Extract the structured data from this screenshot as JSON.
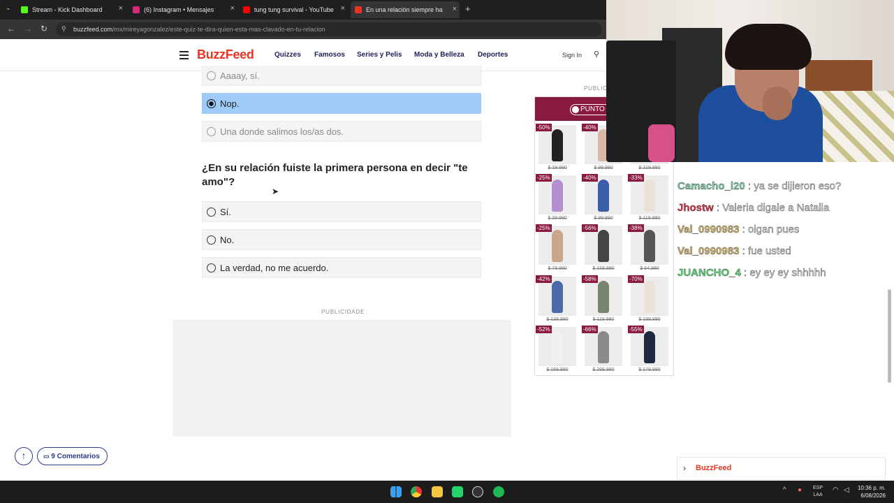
{
  "browser": {
    "tabs": [
      {
        "title": "Stream - Kick Dashboard",
        "icon": "kick-icon",
        "color": "#53fc18"
      },
      {
        "title": "(6) Instagram • Mensajes",
        "icon": "instagram-icon",
        "color": "#d62976"
      },
      {
        "title": "tung tung survival - YouTube",
        "icon": "youtube-icon",
        "color": "#ff0000"
      },
      {
        "title": "En una relación siempre hay un",
        "icon": "buzzfeed-icon",
        "color": "#e32"
      }
    ],
    "new_tab": "+",
    "url_domain": "buzzfeed.com",
    "url_path": "/mx/mireyagonzalez/este-quiz-te-dira-quien-esta-mas-clavado-en-tu-relacion"
  },
  "site": {
    "logo": "BuzzFeed",
    "nav": [
      "Quizzes",
      "Famosos",
      "Series y Pelis",
      "Moda y Belleza",
      "Deportes"
    ],
    "signin": "Sign In"
  },
  "quiz": {
    "previous_options": [
      {
        "label": "Aaaay, sí.",
        "state": "faded"
      },
      {
        "label": "Nop.",
        "state": "selected"
      },
      {
        "label": "Una donde salimos los/as dos.",
        "state": "faded"
      }
    ],
    "question": "¿En su relación fuiste la primera persona en decir \"te amo\"?",
    "options": [
      "Sí.",
      "No.",
      "La verdad, no me acuerdo."
    ]
  },
  "ads": {
    "publicidade": "PUBLICIDADE",
    "side_label": "PUBLICI",
    "brand": "PUNTO",
    "brand_color": "#8a1a3d",
    "products": [
      {
        "discount": "-50%",
        "price": "$ 19.990",
        "color": "#222"
      },
      {
        "discount": "-40%",
        "price": "$ 99.990",
        "color": "#d9b8a8"
      },
      {
        "discount": "",
        "price": "$ 219.990",
        "color": "#ececec"
      },
      {
        "discount": "-25%",
        "price": "$ 39.990",
        "color": "#b48fcf"
      },
      {
        "discount": "-40%",
        "price": "$ 99.990",
        "color": "#3b5ea8"
      },
      {
        "discount": "-33%",
        "price": "$ 119.990",
        "color": "#e9e3d7"
      },
      {
        "discount": "-25%",
        "price": "$ 79.990",
        "color": "#c9a58c"
      },
      {
        "discount": "-56%",
        "price": "$ 159.990",
        "color": "#444"
      },
      {
        "discount": "-38%",
        "price": "$ 64.990",
        "color": "#555"
      },
      {
        "discount": "-42%",
        "price": "$ 139.990",
        "color": "#4a6aa8"
      },
      {
        "discount": "-58%",
        "price": "$ 119.990",
        "color": "#7a8270"
      },
      {
        "discount": "-70%",
        "price": "$ 199.990",
        "color": "#e9e2d6"
      },
      {
        "discount": "-52%",
        "price": "$ 169.990",
        "color": "#f0f0f0"
      },
      {
        "discount": "-66%",
        "price": "$ 289.990",
        "color": "#8a8a8a"
      },
      {
        "discount": "-55%",
        "price": "$ 179.990",
        "color": "#1e2a40"
      }
    ]
  },
  "chat": {
    "messages": [
      {
        "user": "Camacho_l20",
        "text": ": ya se dijieron eso?",
        "color": "#7fd4a8"
      },
      {
        "user": "Jhostw",
        "text": ": Valeria digale a Natalia",
        "color": "#e0304a"
      },
      {
        "user": "Val_0990983",
        "text": ": oigan pues",
        "color": "#d9b86a"
      },
      {
        "user": "Val_0990983",
        "text": ": fue usted",
        "color": "#d9b86a"
      },
      {
        "user": "JUANCHO_4",
        "text": ": ey ey ey shhhhh",
        "color": "#5ce27a"
      }
    ]
  },
  "widget": {
    "label": "BuzzFeed"
  },
  "floating": {
    "up": "↑",
    "comments": "9 Comentarios"
  },
  "taskbar": {
    "lang": "ESP",
    "region": "LAA",
    "time": "10:36 p. m.",
    "date": "6/08/2026"
  }
}
